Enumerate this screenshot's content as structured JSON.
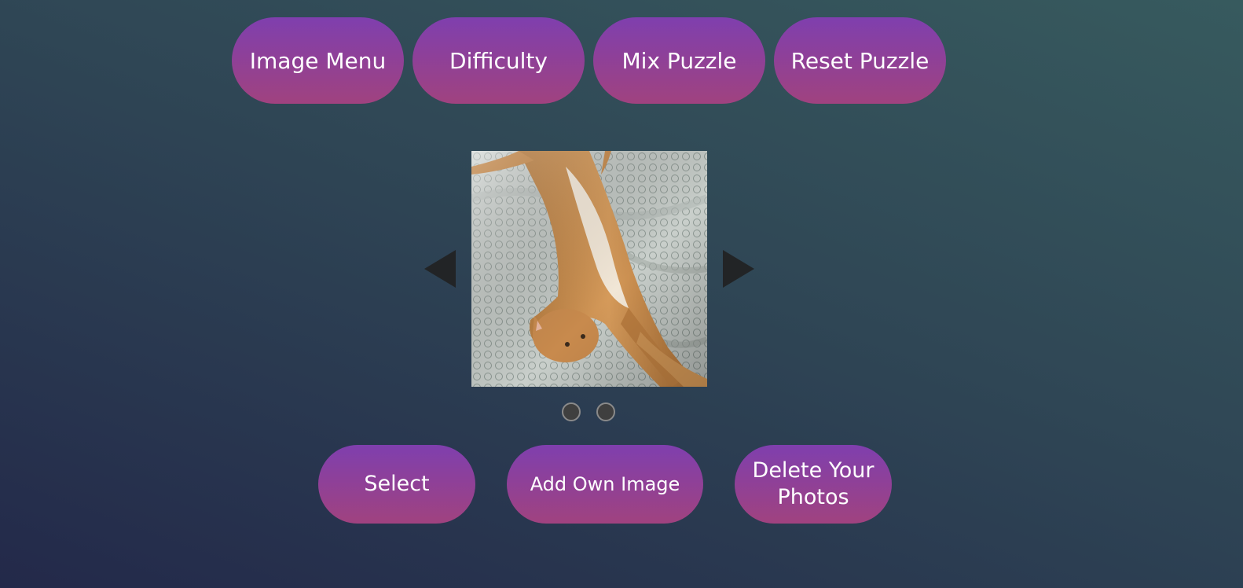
{
  "toolbar": {
    "image_menu_label": "Image Menu",
    "difficulty_label": "Difficulty",
    "mix_label": "Mix Puzzle",
    "reset_label": "Reset Puzzle"
  },
  "carousel": {
    "prev_icon": "triangle-left-icon",
    "next_icon": "triangle-right-icon",
    "image_subject": "orange cat lying on its back on a patterned bedsheet",
    "indicator_count": 2
  },
  "actions": {
    "select_label": "Select",
    "add_label": "Add Own Image",
    "delete_line1": "Delete Your",
    "delete_line2": "Photos"
  },
  "colors": {
    "button_top": "#7f3fae",
    "button_bottom": "#a0427f",
    "arrow": "#222426",
    "background_start": "#375a5e",
    "background_end": "#23294a"
  }
}
